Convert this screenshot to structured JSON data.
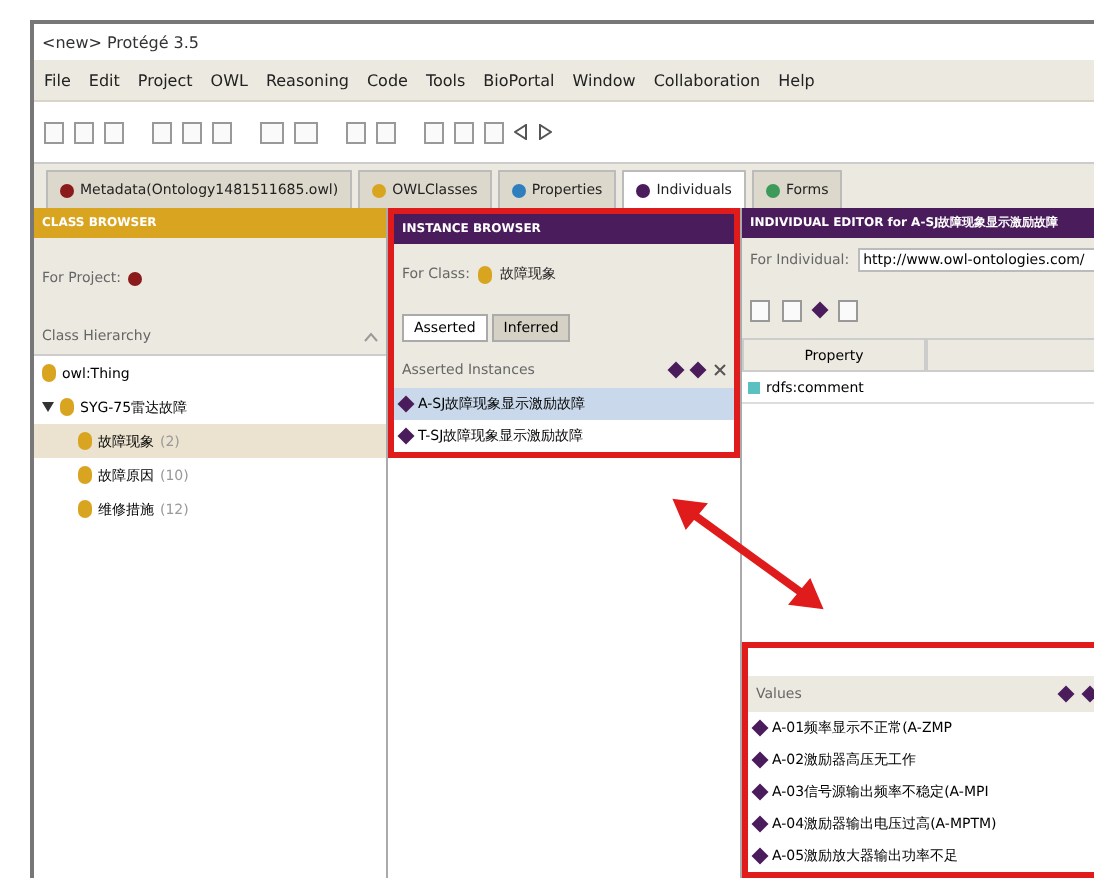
{
  "window": {
    "title": "<new>  Protégé 3.5"
  },
  "menu": [
    "File",
    "Edit",
    "Project",
    "OWL",
    "Reasoning",
    "Code",
    "Tools",
    "BioPortal",
    "Window",
    "Collaboration",
    "Help"
  ],
  "tabs": [
    {
      "label": "Metadata(Ontology1481511685.owl)",
      "selected": false,
      "color": "#8b1a1a"
    },
    {
      "label": "OWLClasses",
      "selected": false,
      "color": "#d9a521"
    },
    {
      "label": "Properties",
      "selected": false,
      "color": "#2f7fbf"
    },
    {
      "label": "Individuals",
      "selected": true,
      "color": "#4b1c5c"
    },
    {
      "label": "Forms",
      "selected": false,
      "color": "#3c9a5a"
    }
  ],
  "class_browser": {
    "title": "CLASS BROWSER",
    "for_project": "For Project:",
    "hierarchy_label": "Class Hierarchy",
    "tree": [
      {
        "label": "owl:Thing",
        "selected": false
      },
      {
        "label": "SYG-75雷达故障",
        "selected": false,
        "expanded": true,
        "children": [
          {
            "label": "故障现象",
            "count": "(2)",
            "selected": true
          },
          {
            "label": "故障原因",
            "count": "(10)",
            "selected": false
          },
          {
            "label": "维修措施",
            "count": "(12)",
            "selected": false
          }
        ]
      }
    ]
  },
  "instance_browser": {
    "title": "INSTANCE BROWSER",
    "for_class_label": "For Class:",
    "for_class": "故障现象",
    "subtabs": [
      {
        "label": "Asserted",
        "selected": true
      },
      {
        "label": "Inferred",
        "selected": false
      }
    ],
    "list_label": "Asserted Instances",
    "instances": [
      {
        "label": "A-SJ故障现象显示激励故障",
        "selected": true
      },
      {
        "label": "T-SJ故障现象显示激励故障",
        "selected": false
      }
    ]
  },
  "individual_editor": {
    "title": "INDIVIDUAL EDITOR for A-SJ故障现象显示激励故障",
    "for_individual_label": "For Individual:",
    "for_individual": "http://www.owl-ontologies.com/",
    "columns": [
      "Property",
      ""
    ],
    "rows": [
      {
        "property": "rdfs:comment",
        "value": ""
      }
    ],
    "values_label": "Values",
    "values": [
      "A-01频率显示不正常(A-ZMP",
      "A-02激励器高压无工作",
      "A-03信号源输出频率不稳定(A-MPI",
      "A-04激励器输出电压过高(A-MPTM)",
      "A-05激励放大器输出功率不足"
    ]
  }
}
